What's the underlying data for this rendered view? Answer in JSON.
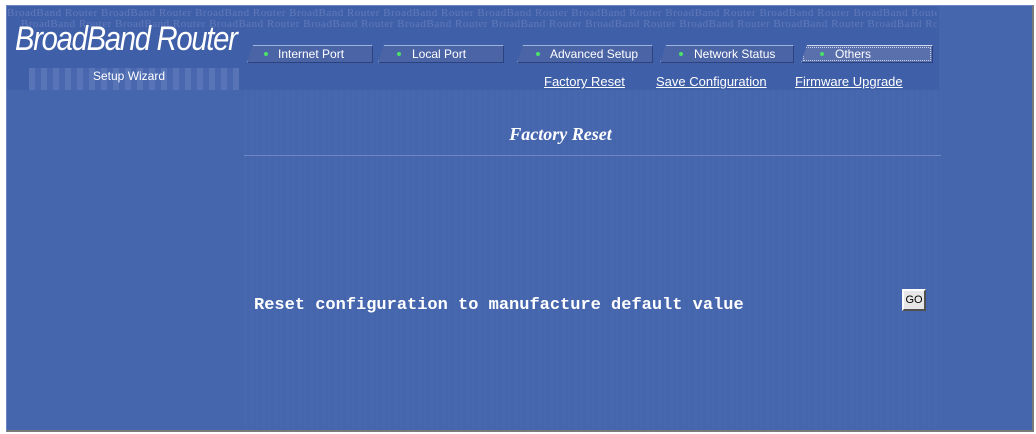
{
  "header": {
    "brand": "BroadBand Router",
    "watermark": "BroadBand Router",
    "wizard_label": "Setup Wizard"
  },
  "tabs": [
    {
      "label": "Internet Port",
      "active": false
    },
    {
      "label": "Local Port",
      "active": false
    },
    {
      "label": "Advanced Setup",
      "active": false
    },
    {
      "label": "Network Status",
      "active": false
    },
    {
      "label": "Others",
      "active": true
    }
  ],
  "sublinks": [
    {
      "label": "Factory Reset"
    },
    {
      "label": "Save Configuration"
    },
    {
      "label": "Firmware Upgrade"
    }
  ],
  "main": {
    "title": "Factory Reset",
    "reset_text": "Reset configuration to manufacture default value",
    "go_label": "GO"
  },
  "colors": {
    "background": "#4565ad",
    "tab_dot": "#49e26a",
    "text": "#ffffff"
  }
}
